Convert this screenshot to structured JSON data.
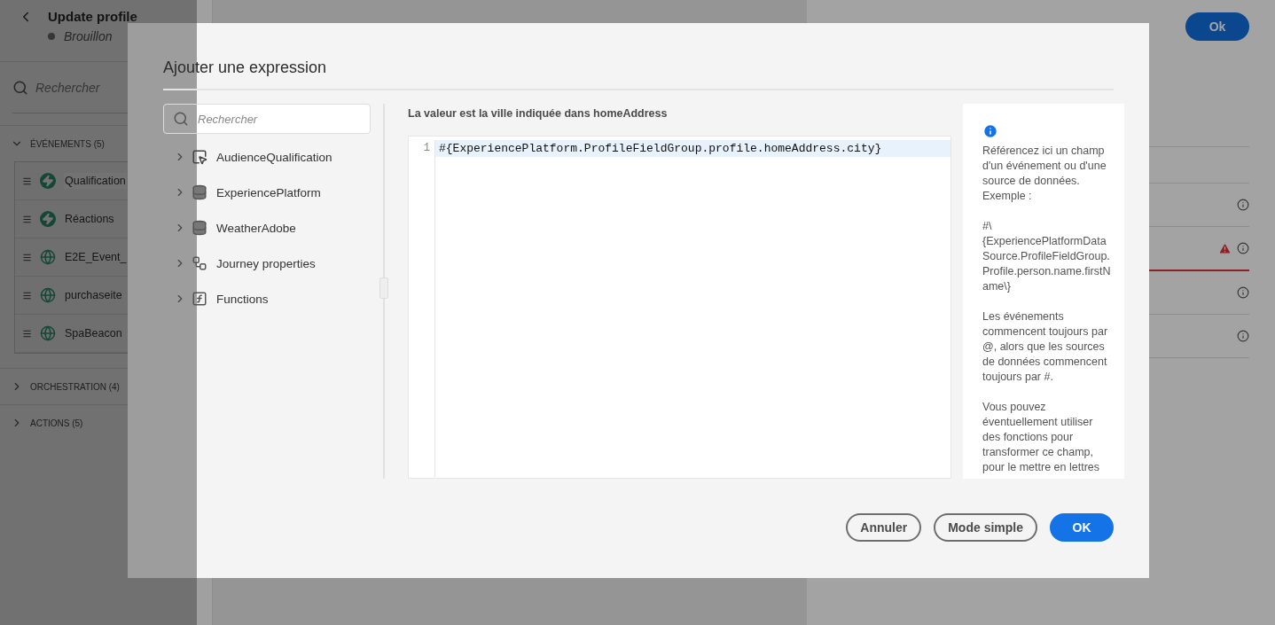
{
  "page": {
    "title": "Update profile",
    "status": "Brouillon",
    "search": {
      "placeholder": "Rechercher"
    },
    "sections": [
      {
        "label": "ÉVÉNEMENTS (5)",
        "expanded": true,
        "items": [
          {
            "label": "Qualification",
            "kind": "bolt",
            "selected": true
          },
          {
            "label": "Réactions",
            "kind": "bolt",
            "selected": false
          },
          {
            "label": "E2E_Event_",
            "kind": "globe",
            "selected": false
          },
          {
            "label": "purchaseite",
            "kind": "globe",
            "selected": false
          },
          {
            "label": "SpaBeacon",
            "kind": "globe",
            "selected": false
          }
        ]
      },
      {
        "label": "ORCHESTRATION (4)",
        "expanded": false
      },
      {
        "label": "ACTIONS (5)",
        "expanded": false
      }
    ],
    "ok_button": "Ok",
    "property_rows": [
      {
        "info": false,
        "warning": false
      },
      {
        "info": true,
        "warning": false
      },
      {
        "info": true,
        "warning": true
      },
      {
        "info": true,
        "warning": false
      },
      {
        "info": true,
        "warning": false
      }
    ]
  },
  "dialog": {
    "title": "Ajouter une expression",
    "search": {
      "placeholder": "Rechercher"
    },
    "tree": [
      {
        "label": "AudienceQualification",
        "kind": "audience",
        "expanded": false
      },
      {
        "label": "ExperiencePlatform",
        "kind": "datasource",
        "expanded": false
      },
      {
        "label": "WeatherAdobe",
        "kind": "datasource",
        "expanded": false
      },
      {
        "label": "Journey properties",
        "kind": "journey",
        "expanded": false
      },
      {
        "label": "Functions",
        "kind": "function",
        "expanded": false
      }
    ],
    "editor_label": "La valeur est la ville indiquée dans homeAddress",
    "editor_lines": [
      {
        "number": "1",
        "code": "#{ExperiencePlatform.ProfileFieldGroup.profile.homeAddress.city}",
        "selected": true
      }
    ],
    "help": [
      "Référencez ici un champ d'un événement ou d'une source de données. Exemple :",
      "#\\{ExperiencePlatformDataSource.ProfileFieldGroup.Profile.person.name.firstName\\}",
      "Les événements commencent toujours par @, alors que les sources de données commencent toujours par #.",
      "Vous pouvez éventuellement utiliser des fonctions pour transformer ce champ, pour le mettre en lettres"
    ],
    "buttons": [
      {
        "label": "Annuler",
        "kind": "secondary"
      },
      {
        "label": "Mode simple",
        "kind": "secondary"
      },
      {
        "label": "OK",
        "kind": "primary"
      }
    ]
  }
}
